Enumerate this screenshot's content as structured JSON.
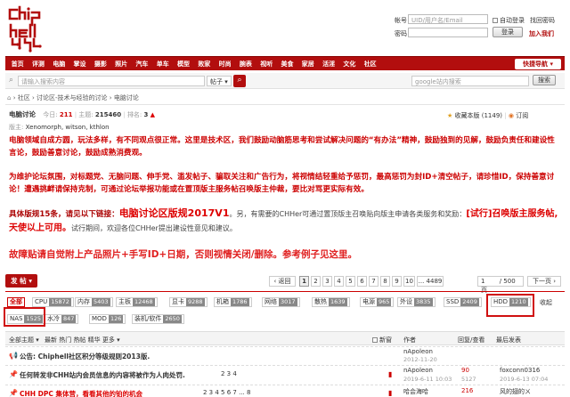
{
  "logo": {
    "text": "chiphell"
  },
  "login": {
    "account_label": "帐号",
    "account_placeholder": "UID/用户名/Email",
    "auto_login": "自动登录",
    "forgot_password": "找回密码",
    "password_label": "密码",
    "login_button": "登录",
    "join_link": "加入我们"
  },
  "nav": {
    "items": [
      "首页",
      "评测",
      "电脑",
      "掌设",
      "摄影",
      "照片",
      "汽车",
      "单车",
      "模型",
      "败家",
      "时尚",
      "腕表",
      "视听",
      "美食",
      "家居",
      "活淫",
      "文化",
      "社区"
    ],
    "quick": "快捷导航"
  },
  "search": {
    "placeholder": "请输入搜索内容",
    "type": "帖子",
    "google_placeholder": "google站内搜索",
    "google_button": "搜索"
  },
  "breadcrumb": {
    "items": [
      "社区",
      "讨论区-技术与经验的讨论",
      "电脑讨论"
    ],
    "sep": "›"
  },
  "forum": {
    "name": "电脑讨论",
    "today_label": "今日:",
    "today": "211",
    "theme_label": "主题:",
    "theme": "215460",
    "rank_label": "排名:",
    "rank": "3",
    "moderators_label": "版主:",
    "moderators": "Xenomorph, witson, kthlon",
    "favorite": "收藏本版 (1149)",
    "subscribe": "订阅"
  },
  "rules": {
    "p1": "电脑领域自成方圆，玩法多样，有不同观点很正常。这里是技术区，我们鼓励动脑筋思考和尝试解决问题的“有办法”精神，鼓励独到的见解，鼓励负责任和建设性言论，鼓励善意讨论，鼓励成熟消费观。",
    "p2": "为维护论坛氛围，对标题党、无脑问题、伸手党、滥发帖子、骗取关注和广告行为，将视情结轻重给予惩罚，最高惩罚为封ID+清空帖子，请珍惜ID，保持善意讨论！遭遇挑衅请保持克制，可通过论坛举报功能或在置顶版主服务帖召唤版主仲裁，要比对骂更实际有效。",
    "p3_a": "具体版规15条，请见以下链接：",
    "p3_link": "电脑讨论区版规2017V1",
    "p3_b": "。另，有需要的CHHer可通过置顶版主召唤贴向版主申请各类服务和奖励：",
    "p3_c": "[试行]召唤版主服务帖,天使以上可用。",
    "p3_d": "试行期间，欢迎各位CHHer提出建设性意见和建议。",
    "p4": "故障贴请自觉附上产品照片+手写ID+日期，否则视情关闭/删除。参考例子见这里。"
  },
  "toolbar": {
    "post_button": "发 帖",
    "back": "‹ 返回",
    "pages": [
      "1",
      "2",
      "3",
      "4",
      "5",
      "6",
      "7",
      "8",
      "9",
      "10",
      "... 4489"
    ],
    "page_current": "1",
    "page_total": "/ 500 页",
    "next": "下一页 ›"
  },
  "tags": [
    {
      "name": "全部",
      "count": ""
    },
    {
      "name": "CPU",
      "count": "15872"
    },
    {
      "name": "内存",
      "count": "5403"
    },
    {
      "name": "主板",
      "count": "12468"
    },
    {
      "name": "显卡",
      "count": "9288"
    },
    {
      "name": "机箱",
      "count": "1786"
    },
    {
      "name": "网络",
      "count": "3017"
    },
    {
      "name": "散热",
      "count": "1639"
    },
    {
      "name": "电源",
      "count": "965"
    },
    {
      "name": "外设",
      "count": "3835"
    },
    {
      "name": "SSD",
      "count": "2409"
    },
    {
      "name": "HDD",
      "count": "1210"
    },
    {
      "name": "收起",
      "count": ""
    },
    {
      "name": "NAS",
      "count": "1525"
    },
    {
      "name": "水冷",
      "count": "847"
    },
    {
      "name": "MOD",
      "count": "126"
    },
    {
      "name": "装机/软件",
      "count": "2650"
    }
  ],
  "list_header": {
    "filters": [
      "全部主题",
      "最新",
      "热门",
      "热帖",
      "精华",
      "更多"
    ],
    "new_window": "新窗",
    "author": "作者",
    "replies": "回复/查看",
    "last_post": "最后发表"
  },
  "rows": [
    {
      "title": "公告: Chiphell社区积分等级规则2013版.",
      "author": "nApoleon",
      "date": "2012-11-20",
      "replies": "",
      "views": "",
      "last_author": "",
      "last_date": ""
    },
    {
      "title": "任何转发非CHH站内会员信息的内容将被作为人肉处罚.",
      "pages": "2 3 4",
      "author": "nApoleon",
      "date": "2019-6-11 10:03",
      "replies": "90",
      "views": "5127",
      "last_author": "foxconn0316",
      "last_date": "2019-6-13 07:04"
    },
    {
      "title": "CHH DPC 集体营，看看其他的铂的机会",
      "pages": "2 3 4 5 6 7 ... 8",
      "author": "哈会海哈",
      "date": "",
      "replies": "216",
      "views": "",
      "last_author": "风的翅的ㄨ",
      "last_date": ""
    }
  ]
}
